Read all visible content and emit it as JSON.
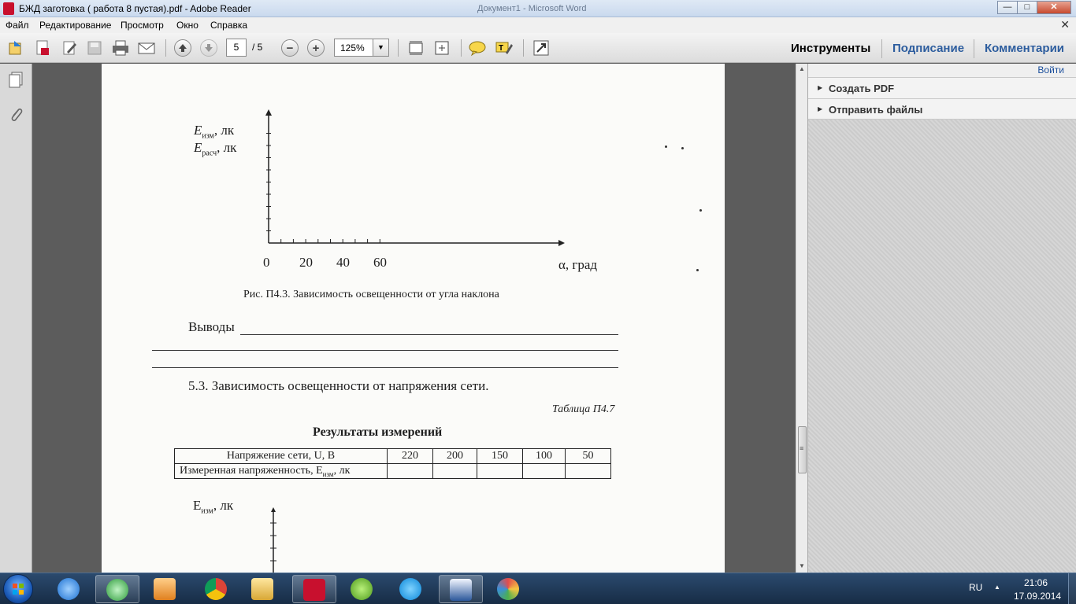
{
  "window": {
    "title": "БЖД заготовка ( работа 8 пустая).pdf - Adobe Reader",
    "background_title": "Документ1 - Microsoft Word",
    "controls": {
      "minimize": "—",
      "maximize": "□",
      "close": "✕"
    }
  },
  "menu": {
    "items": [
      "Файл",
      "Редактирование",
      "Просмотр",
      "Окно",
      "Справка"
    ],
    "close": "✕"
  },
  "toolbar": {
    "page_current": "5",
    "page_total": "/ 5",
    "zoom": "125%",
    "zoom_arrow": "▼",
    "zoom_out": "−",
    "zoom_in": "+",
    "tabs": [
      "Инструменты",
      "Подписание",
      "Комментарии"
    ]
  },
  "right_pane": {
    "login": "Войти",
    "items": [
      "Создать PDF",
      "Отправить файлы"
    ],
    "triangle": "▶"
  },
  "scrollbar": {
    "up": "▲",
    "down": "▼",
    "grip": "≡"
  },
  "document": {
    "chart1": {
      "ylabel_1_main": "E",
      "ylabel_1_sub": "изм",
      "ylabel_1_unit": ", лк",
      "ylabel_2_main": "E",
      "ylabel_2_sub": "расч",
      "ylabel_2_unit": ", лк",
      "x_ticks": [
        "0",
        "20",
        "40",
        "60"
      ],
      "xlabel": "α, град",
      "caption": "Рис. П4.3. Зависимость освещенности от угла наклона"
    },
    "conclusions_label": "Выводы",
    "section_title": "5.3. Зависимость освещенности от напряжения сети.",
    "table_label": "Таблица П4.7",
    "table_title": "Результаты измерений",
    "table": {
      "row1_header": "Напряжение сети, U, В",
      "row1_values": [
        "220",
        "200",
        "150",
        "100",
        "50"
      ],
      "row2_header_main": "Измеренная напряженность, E",
      "row2_header_sub": "изм",
      "row2_header_unit": ", лк"
    },
    "chart2": {
      "ylabel_main": "E",
      "ylabel_sub": "изм",
      "ylabel_unit": ", лк"
    }
  },
  "taskbar": {
    "lang": "RU",
    "tray_arrow": "▲",
    "time": "21:06",
    "date": "17.09.2014",
    "apps": [
      "internet-explorer",
      "messenger",
      "media-player",
      "chrome",
      "file-explorer",
      "adobe-reader",
      "utorrent",
      "skype",
      "word",
      "paint"
    ]
  },
  "colors": {
    "reader_red": "#c8102e",
    "taskbar": "#1f3a5c",
    "link_blue": "#1b4f9c"
  }
}
